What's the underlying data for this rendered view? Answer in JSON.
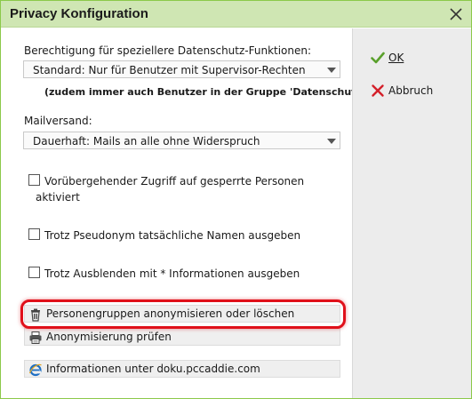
{
  "window": {
    "title": "Privacy Konfiguration"
  },
  "permissions": {
    "label": "Berechtigung für speziellere Datenschutz-Funktionen:",
    "selected": "Standard: Nur für Benutzer mit Supervisor-Rechten",
    "note": "(zudem immer auch Benutzer in der Gruppe 'Datenschutz')"
  },
  "mail": {
    "label": "Mailversand:",
    "selected": "Dauerhaft: Mails an alle ohne Widerspruch"
  },
  "checks": {
    "temp_access_line1": "Vorübergehender Zugriff auf gesperrte Personen",
    "temp_access_line2": "aktiviert",
    "real_names": "Trotz Pseudonym tatsächliche Namen ausgeben",
    "hidden_info": "Trotz Ausblenden mit * Informationen ausgeben"
  },
  "buttons": {
    "anonymize_groups": "Personengruppen anonymisieren oder löschen",
    "check_anonymization": "Anonymisierung prüfen",
    "info_link": "Informationen unter doku.pccaddie.com"
  },
  "side": {
    "ok": "OK",
    "cancel": "Abbruch"
  },
  "colors": {
    "titlebar": "#cfe6b3",
    "border": "#8cc94a",
    "highlight": "#e0101a",
    "ok_check": "#5aa02c",
    "cancel_x": "#d4202a"
  },
  "icons": {
    "close": "close-icon",
    "trash": "trash-icon",
    "printer": "printer-icon",
    "browser": "internet-explorer-icon",
    "ok": "checkmark-icon",
    "cancel": "cross-icon"
  }
}
